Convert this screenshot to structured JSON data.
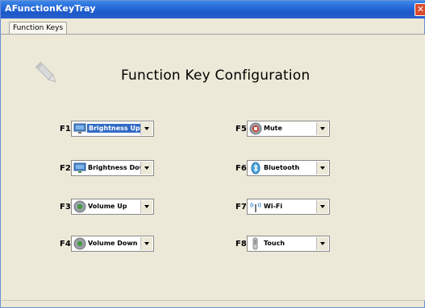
{
  "window": {
    "title": "AFunctionKeyTray",
    "close_glyph": "✕"
  },
  "tabs": [
    {
      "label": "Function Keys"
    }
  ],
  "heading": "Function Key Configuration",
  "keys": [
    {
      "key": "F1",
      "value": "Brightness Up",
      "icon": "monitor-icon"
    },
    {
      "key": "F2",
      "value": "Brightness Down",
      "icon": "monitor-icon"
    },
    {
      "key": "F3",
      "value": "Volume Up",
      "icon": "speaker-icon"
    },
    {
      "key": "F4",
      "value": "Volume Down",
      "icon": "speaker-icon"
    },
    {
      "key": "F5",
      "value": "Mute",
      "icon": "mute-icon"
    },
    {
      "key": "F6",
      "value": "Bluetooth",
      "icon": "bluetooth-icon"
    },
    {
      "key": "F7",
      "value": "Wi-Fi",
      "icon": "wifi-icon"
    },
    {
      "key": "F8",
      "value": "Touch",
      "icon": "touch-icon"
    }
  ],
  "colors": {
    "titlebar": "#2567d8",
    "selection": "#316ac5",
    "panel": "#ece9d8"
  }
}
